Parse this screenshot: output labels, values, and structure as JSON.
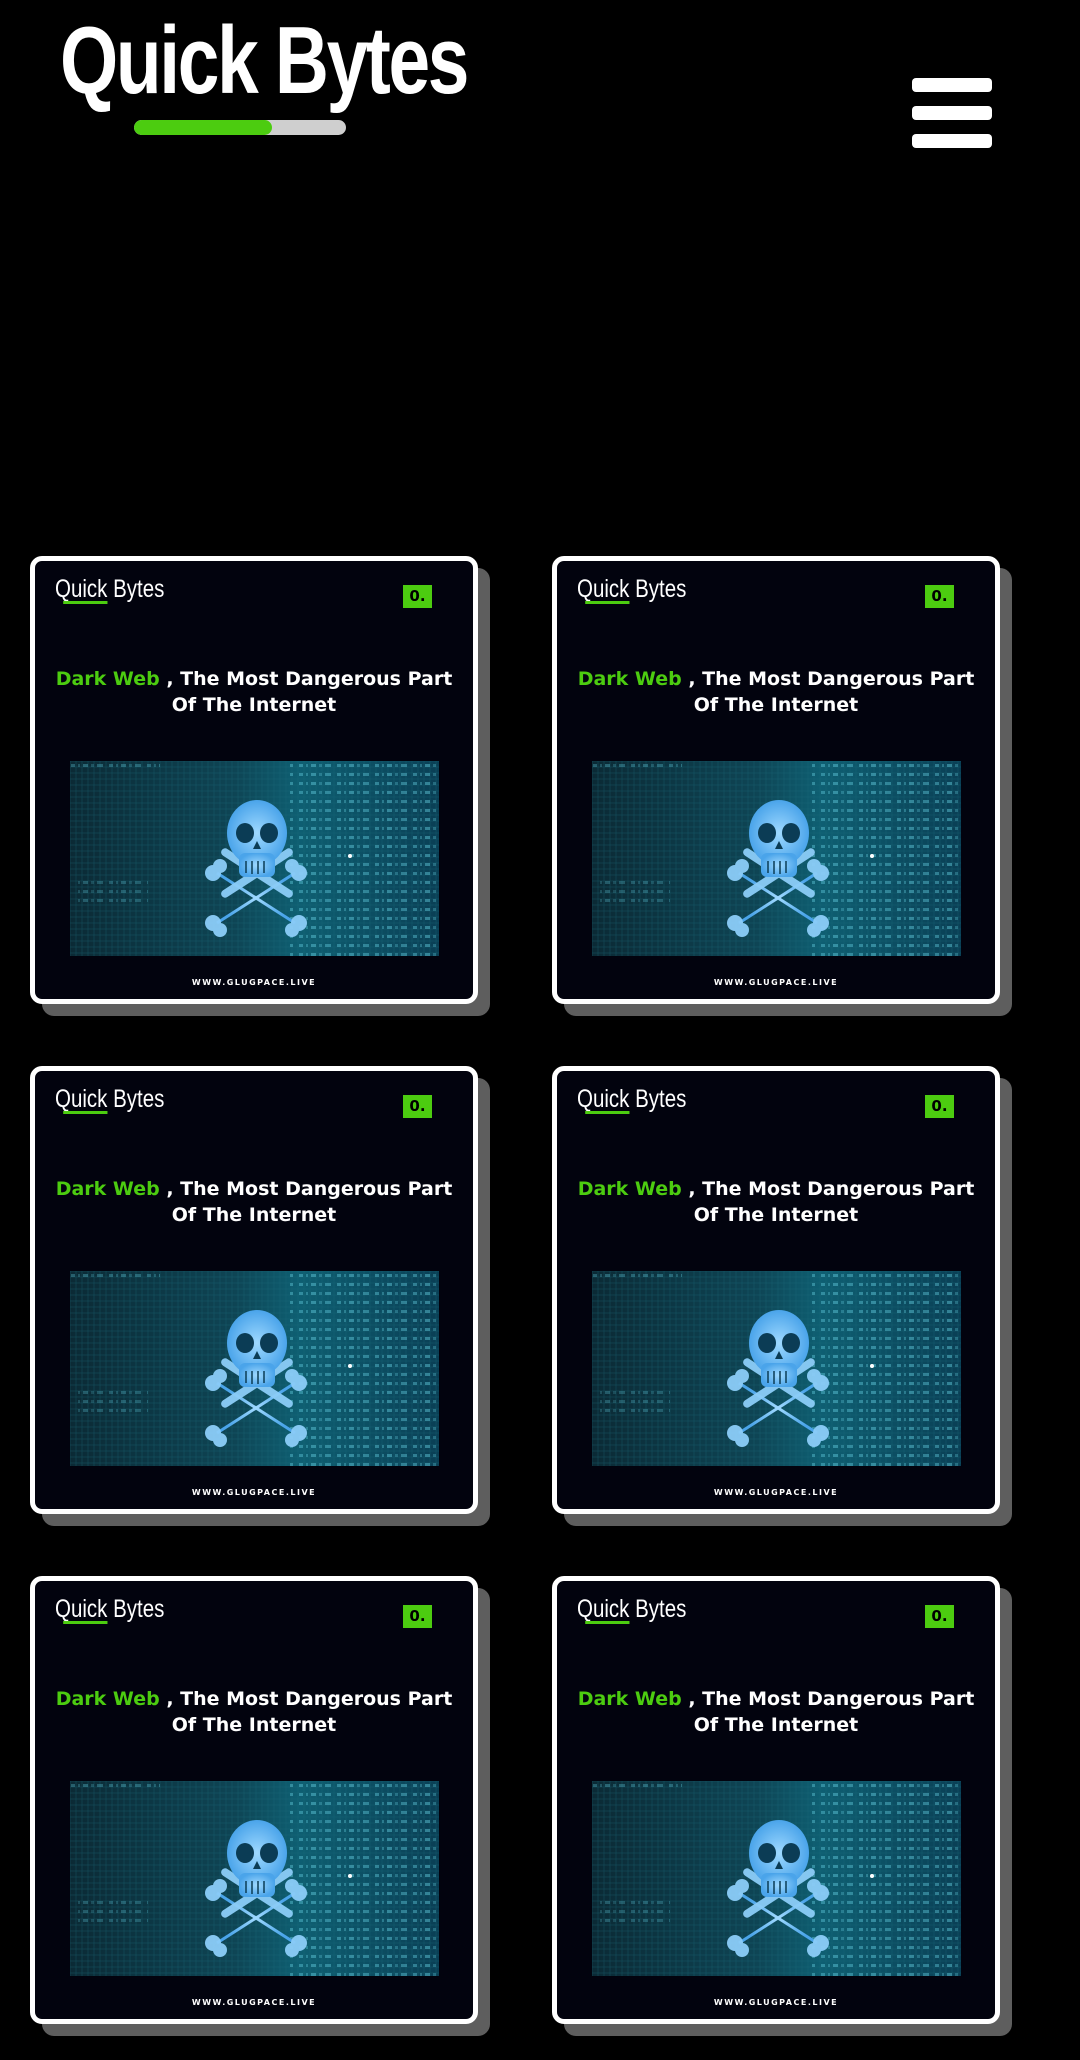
{
  "header": {
    "title": "Quick Bytes",
    "progress_percent": 65,
    "menu_icon": "hamburger-menu-icon"
  },
  "cards": [
    {
      "brand_a": "Quick",
      "brand_b": " Bytes",
      "badge": "0.",
      "headline_highlight": "Dark Web",
      "headline_rest": " , The Most Dangerous Part Of The Internet",
      "image_icon": "skull-crossbones-icon",
      "url": "WWW.GLUGPACE.LIVE"
    },
    {
      "brand_a": "Quick",
      "brand_b": " Bytes",
      "badge": "0.",
      "headline_highlight": "Dark Web",
      "headline_rest": " , The Most Dangerous Part Of The Internet",
      "image_icon": "skull-crossbones-icon",
      "url": "WWW.GLUGPACE.LIVE"
    },
    {
      "brand_a": "Quick",
      "brand_b": " Bytes",
      "badge": "0.",
      "headline_highlight": "Dark Web",
      "headline_rest": " , The Most Dangerous Part Of The Internet",
      "image_icon": "skull-crossbones-icon",
      "url": "WWW.GLUGPACE.LIVE"
    },
    {
      "brand_a": "Quick",
      "brand_b": " Bytes",
      "badge": "0.",
      "headline_highlight": "Dark Web",
      "headline_rest": " , The Most Dangerous Part Of The Internet",
      "image_icon": "skull-crossbones-icon",
      "url": "WWW.GLUGPACE.LIVE"
    },
    {
      "brand_a": "Quick",
      "brand_b": " Bytes",
      "badge": "0.",
      "headline_highlight": "Dark Web",
      "headline_rest": " , The Most Dangerous Part Of The Internet",
      "image_icon": "skull-crossbones-icon",
      "url": "WWW.GLUGPACE.LIVE"
    },
    {
      "brand_a": "Quick",
      "brand_b": " Bytes",
      "badge": "0.",
      "headline_highlight": "Dark Web",
      "headline_rest": " , The Most Dangerous Part Of The Internet",
      "image_icon": "skull-crossbones-icon",
      "url": "WWW.GLUGPACE.LIVE"
    }
  ],
  "colors": {
    "accent": "#4ccc10",
    "background": "#000000",
    "card_background": "#02030e",
    "card_border": "#ffffff",
    "card_shadow": "#5e5e5e"
  }
}
